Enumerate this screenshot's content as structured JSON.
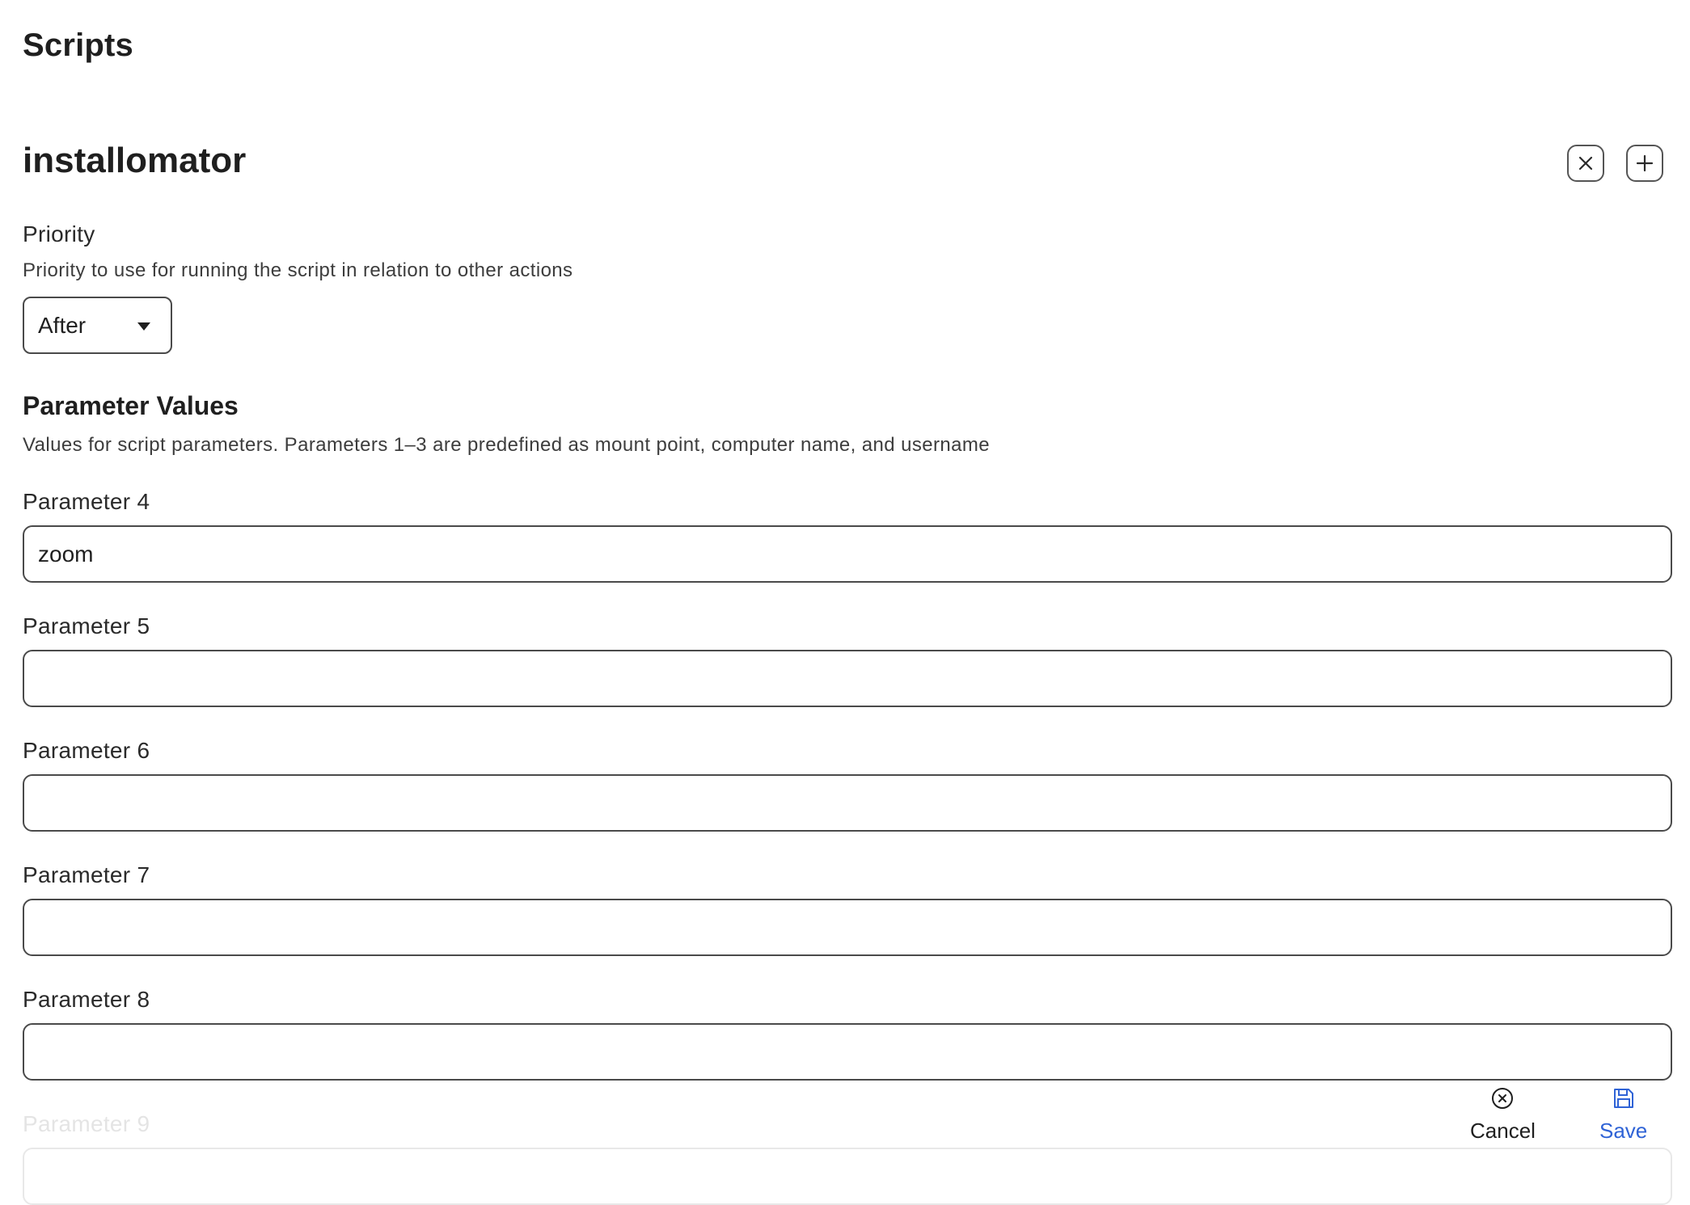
{
  "page": {
    "title": "Scripts"
  },
  "script": {
    "name": "installomator",
    "remove_icon": "close-icon",
    "add_icon": "plus-icon"
  },
  "priority": {
    "label": "Priority",
    "description": "Priority to use for running the script in relation to other actions",
    "selected": "After",
    "dropdown_icon": "caret-down-icon"
  },
  "parameters": {
    "title": "Parameter Values",
    "description": "Values for script parameters. Parameters 1–3 are predefined as mount point, computer name, and username",
    "fields": [
      {
        "label": "Parameter 4",
        "value": "zoom"
      },
      {
        "label": "Parameter 5",
        "value": ""
      },
      {
        "label": "Parameter 6",
        "value": ""
      },
      {
        "label": "Parameter 7",
        "value": ""
      },
      {
        "label": "Parameter 8",
        "value": ""
      },
      {
        "label": "Parameter 9",
        "value": ""
      }
    ]
  },
  "footer": {
    "cancel_label": "Cancel",
    "cancel_icon": "circle-x-icon",
    "save_label": "Save",
    "save_icon": "floppy-disk-icon",
    "save_color": "#2f63d6"
  }
}
